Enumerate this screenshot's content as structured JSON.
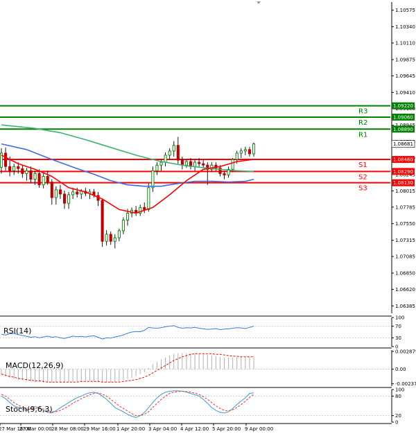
{
  "chart_data": [
    {
      "type": "candlestick",
      "title": "",
      "y_ticks": [
        "1.10575",
        "1.10340",
        "1.10110",
        "1.09875",
        "1.09645",
        "1.09410",
        "1.09180",
        "1.08945",
        "1.08710",
        "1.08480",
        "1.08245",
        "1.08015",
        "1.07785",
        "1.07550",
        "1.07315",
        "1.07085",
        "1.06850",
        "1.06620",
        "1.06385"
      ],
      "ylim": [
        1.0628,
        1.1069
      ],
      "x_ticks": [
        "27 Mar 16:00",
        "27 Mar 00:00",
        "28 Mar 08:00",
        "29 Mar 16:00",
        "1 Apr 20:00",
        "3 Apr 04:00",
        "4 Apr 12:00",
        "5 Apr 20:00",
        "9 Apr 00:00"
      ],
      "current_price": "1.08681",
      "levels": [
        {
          "name": "R3",
          "value": 1.0922,
          "label": "1.09220",
          "color": "#008000"
        },
        {
          "name": "R2",
          "value": 1.0906,
          "label": "1.09060",
          "color": "#008000"
        },
        {
          "name": "R1",
          "value": 1.0889,
          "label": "1.08890",
          "color": "#008000"
        },
        {
          "name": "S1",
          "value": 1.0846,
          "label": "1.08460",
          "color": "#ff0000"
        },
        {
          "name": "S2",
          "value": 1.0829,
          "label": "1.08290",
          "color": "#ff0000"
        },
        {
          "name": "S3",
          "value": 1.0813,
          "label": "1.08130",
          "color": "#ff0000"
        }
      ],
      "candles": [
        {
          "o": 1.0835,
          "h": 1.0862,
          "l": 1.0826,
          "c": 1.0855
        },
        {
          "o": 1.0855,
          "h": 1.0863,
          "l": 1.083,
          "c": 1.0836
        },
        {
          "o": 1.0836,
          "h": 1.085,
          "l": 1.0822,
          "c": 1.083
        },
        {
          "o": 1.083,
          "h": 1.084,
          "l": 1.0824,
          "c": 1.0836
        },
        {
          "o": 1.0836,
          "h": 1.0842,
          "l": 1.0826,
          "c": 1.0833
        },
        {
          "o": 1.0833,
          "h": 1.0838,
          "l": 1.082,
          "c": 1.0826
        },
        {
          "o": 1.0826,
          "h": 1.0834,
          "l": 1.0816,
          "c": 1.083
        },
        {
          "o": 1.083,
          "h": 1.0836,
          "l": 1.0812,
          "c": 1.0818
        },
        {
          "o": 1.0818,
          "h": 1.083,
          "l": 1.081,
          "c": 1.0826
        },
        {
          "o": 1.0826,
          "h": 1.0832,
          "l": 1.0806,
          "c": 1.081
        },
        {
          "o": 1.081,
          "h": 1.0826,
          "l": 1.0805,
          "c": 1.0822
        },
        {
          "o": 1.0822,
          "h": 1.083,
          "l": 1.081,
          "c": 1.0814
        },
        {
          "o": 1.0814,
          "h": 1.0818,
          "l": 1.0782,
          "c": 1.0792
        },
        {
          "o": 1.0792,
          "h": 1.0808,
          "l": 1.0782,
          "c": 1.0803
        },
        {
          "o": 1.0803,
          "h": 1.081,
          "l": 1.079,
          "c": 1.0797
        },
        {
          "o": 1.0797,
          "h": 1.0802,
          "l": 1.0776,
          "c": 1.0784
        },
        {
          "o": 1.0784,
          "h": 1.08,
          "l": 1.0776,
          "c": 1.0796
        },
        {
          "o": 1.0796,
          "h": 1.0806,
          "l": 1.079,
          "c": 1.08
        },
        {
          "o": 1.08,
          "h": 1.0806,
          "l": 1.0792,
          "c": 1.0797
        },
        {
          "o": 1.0797,
          "h": 1.0804,
          "l": 1.079,
          "c": 1.0801
        },
        {
          "o": 1.0801,
          "h": 1.0806,
          "l": 1.0794,
          "c": 1.0798
        },
        {
          "o": 1.0798,
          "h": 1.0804,
          "l": 1.079,
          "c": 1.08
        },
        {
          "o": 1.08,
          "h": 1.0804,
          "l": 1.0792,
          "c": 1.0795
        },
        {
          "o": 1.0795,
          "h": 1.08,
          "l": 1.078,
          "c": 1.0788
        },
        {
          "o": 1.0788,
          "h": 1.079,
          "l": 1.0722,
          "c": 1.073
        },
        {
          "o": 1.073,
          "h": 1.0746,
          "l": 1.0724,
          "c": 1.074
        },
        {
          "o": 1.074,
          "h": 1.0744,
          "l": 1.0725,
          "c": 1.073
        },
        {
          "o": 1.073,
          "h": 1.074,
          "l": 1.072,
          "c": 1.0735
        },
        {
          "o": 1.0735,
          "h": 1.0748,
          "l": 1.073,
          "c": 1.0745
        },
        {
          "o": 1.0745,
          "h": 1.0764,
          "l": 1.074,
          "c": 1.076
        },
        {
          "o": 1.076,
          "h": 1.0776,
          "l": 1.0752,
          "c": 1.077
        },
        {
          "o": 1.077,
          "h": 1.0778,
          "l": 1.0764,
          "c": 1.0774
        },
        {
          "o": 1.0774,
          "h": 1.078,
          "l": 1.0766,
          "c": 1.077
        },
        {
          "o": 1.077,
          "h": 1.0782,
          "l": 1.0766,
          "c": 1.0778
        },
        {
          "o": 1.0778,
          "h": 1.0785,
          "l": 1.077,
          "c": 1.0775
        },
        {
          "o": 1.0775,
          "h": 1.0812,
          "l": 1.0772,
          "c": 1.0806
        },
        {
          "o": 1.0806,
          "h": 1.0836,
          "l": 1.08,
          "c": 1.083
        },
        {
          "o": 1.083,
          "h": 1.0842,
          "l": 1.0824,
          "c": 1.0838
        },
        {
          "o": 1.0838,
          "h": 1.0846,
          "l": 1.083,
          "c": 1.0842
        },
        {
          "o": 1.0842,
          "h": 1.0856,
          "l": 1.0836,
          "c": 1.0852
        },
        {
          "o": 1.0852,
          "h": 1.0862,
          "l": 1.0846,
          "c": 1.0858
        },
        {
          "o": 1.0858,
          "h": 1.0872,
          "l": 1.085,
          "c": 1.0866
        },
        {
          "o": 1.0866,
          "h": 1.0878,
          "l": 1.084,
          "c": 1.0845
        },
        {
          "o": 1.0845,
          "h": 1.085,
          "l": 1.0832,
          "c": 1.0838
        },
        {
          "o": 1.0838,
          "h": 1.0846,
          "l": 1.0834,
          "c": 1.0843
        },
        {
          "o": 1.0843,
          "h": 1.0848,
          "l": 1.0832,
          "c": 1.0836
        },
        {
          "o": 1.0836,
          "h": 1.0846,
          "l": 1.083,
          "c": 1.0842
        },
        {
          "o": 1.0842,
          "h": 1.0848,
          "l": 1.0836,
          "c": 1.084
        },
        {
          "o": 1.084,
          "h": 1.0846,
          "l": 1.0834,
          "c": 1.0838
        },
        {
          "o": 1.0838,
          "h": 1.0842,
          "l": 1.081,
          "c": 1.0832
        },
        {
          "o": 1.0832,
          "h": 1.0842,
          "l": 1.0828,
          "c": 1.0838
        },
        {
          "o": 1.0838,
          "h": 1.0842,
          "l": 1.083,
          "c": 1.0834
        },
        {
          "o": 1.0834,
          "h": 1.0838,
          "l": 1.0822,
          "c": 1.0826
        },
        {
          "o": 1.0826,
          "h": 1.083,
          "l": 1.0818,
          "c": 1.0824
        },
        {
          "o": 1.0824,
          "h": 1.0836,
          "l": 1.082,
          "c": 1.0832
        },
        {
          "o": 1.0832,
          "h": 1.0848,
          "l": 1.0828,
          "c": 1.0846
        },
        {
          "o": 1.0846,
          "h": 1.0858,
          "l": 1.084,
          "c": 1.0855
        },
        {
          "o": 1.0855,
          "h": 1.0862,
          "l": 1.0848,
          "c": 1.0858
        },
        {
          "o": 1.0858,
          "h": 1.0864,
          "l": 1.0852,
          "c": 1.086
        },
        {
          "o": 1.086,
          "h": 1.0864,
          "l": 1.085,
          "c": 1.0854
        },
        {
          "o": 1.0854,
          "h": 1.087,
          "l": 1.085,
          "c": 1.0868
        }
      ],
      "ma_series": [
        {
          "color": "#3cb371",
          "points": [
            [
              0,
              1.0895
            ],
            [
              8,
              1.089
            ],
            [
              14,
              1.0884
            ],
            [
              20,
              1.0874
            ],
            [
              26,
              1.0863
            ],
            [
              32,
              1.0852
            ],
            [
              38,
              1.0843
            ],
            [
              44,
              1.0837
            ],
            [
              50,
              1.0833
            ],
            [
              56,
              1.083
            ],
            [
              60,
              1.0829
            ]
          ]
        },
        {
          "color": "#4169e1",
          "points": [
            [
              0,
              1.0868
            ],
            [
              6,
              1.086
            ],
            [
              12,
              1.0846
            ],
            [
              18,
              1.0833
            ],
            [
              22,
              1.0825
            ],
            [
              26,
              1.0816
            ],
            [
              30,
              1.081
            ],
            [
              34,
              1.0808
            ],
            [
              38,
              1.0808
            ],
            [
              42,
              1.0812
            ],
            [
              46,
              1.0815
            ],
            [
              50,
              1.0815
            ],
            [
              54,
              1.0814
            ],
            [
              58,
              1.0815
            ],
            [
              60,
              1.0818
            ]
          ]
        },
        {
          "color": "#ff0000",
          "points": [
            [
              0,
              1.0852
            ],
            [
              4,
              1.084
            ],
            [
              8,
              1.0832
            ],
            [
              12,
              1.0822
            ],
            [
              16,
              1.0806
            ],
            [
              20,
              1.08
            ],
            [
              24,
              1.079
            ],
            [
              28,
              1.0775
            ],
            [
              32,
              1.077
            ],
            [
              36,
              1.0778
            ],
            [
              40,
              1.0796
            ],
            [
              44,
              1.0816
            ],
            [
              48,
              1.0832
            ],
            [
              52,
              1.0836
            ],
            [
              56,
              1.0843
            ],
            [
              60,
              1.0846
            ]
          ]
        }
      ]
    },
    {
      "type": "line",
      "name": "RSI(14)",
      "y_ticks": [
        "100",
        "70",
        "30",
        "0"
      ],
      "ylim": [
        0,
        100
      ],
      "series": [
        {
          "color": "#3a7bd5",
          "values": [
            42,
            40,
            44,
            45,
            41,
            38,
            35,
            32,
            34,
            30,
            33,
            36,
            32,
            34,
            30,
            28,
            32,
            36,
            34,
            35,
            33,
            36,
            37,
            32,
            26,
            30,
            29,
            33,
            36,
            40,
            46,
            50,
            52,
            51,
            56,
            66,
            64,
            63,
            65,
            68,
            70,
            72,
            66,
            63,
            65,
            64,
            66,
            63,
            61,
            59,
            60,
            62,
            58,
            60,
            61,
            63,
            65,
            64,
            62,
            66,
            70
          ]
        }
      ]
    },
    {
      "type": "bar",
      "name": "MACD(12,26,9)",
      "y_ticks": [
        "0.002879",
        "0.00",
        "-0.002379"
      ],
      "ylim": [
        -0.00275,
        0.0031
      ],
      "histogram": [
        -0.001,
        -0.0012,
        -0.0014,
        -0.0016,
        -0.0017,
        -0.0018,
        -0.0019,
        -0.002,
        -0.0021,
        -0.0021,
        -0.0022,
        -0.0022,
        -0.0022,
        -0.0022,
        -0.0022,
        -0.0022,
        -0.0021,
        -0.0021,
        -0.002,
        -0.002,
        -0.0019,
        -0.0019,
        -0.002,
        -0.0021,
        -0.0022,
        -0.0022,
        -0.0022,
        -0.0021,
        -0.002,
        -0.0018,
        -0.0016,
        -0.0014,
        -0.0011,
        -0.0008,
        -0.0005,
        0.0002,
        0.0008,
        0.0012,
        0.0016,
        0.0019,
        0.0022,
        0.0025,
        0.0026,
        0.0026,
        0.0026,
        0.0026,
        0.0026,
        0.0025,
        0.0024,
        0.0023,
        0.0022,
        0.0021,
        0.002,
        0.0019,
        0.0019,
        0.0019,
        0.002,
        0.002,
        0.002,
        0.002,
        0.0021
      ],
      "signal": [
        -0.0008,
        -0.001,
        -0.0012,
        -0.0013,
        -0.0015,
        -0.0016,
        -0.0017,
        -0.0018,
        -0.0019,
        -0.0019,
        -0.002,
        -0.0021,
        -0.0021,
        -0.0021,
        -0.0021,
        -0.0021,
        -0.0021,
        -0.0021,
        -0.0021,
        -0.002,
        -0.002,
        -0.002,
        -0.002,
        -0.002,
        -0.0021,
        -0.0021,
        -0.0021,
        -0.0021,
        -0.0021,
        -0.002,
        -0.0019,
        -0.0018,
        -0.0017,
        -0.0015,
        -0.0013,
        -0.001,
        -0.0006,
        -0.0002,
        0.0002,
        0.0006,
        0.001,
        0.0014,
        0.0017,
        0.002,
        0.0022,
        0.0024,
        0.0025,
        0.0025,
        0.0025,
        0.0025,
        0.0025,
        0.0024,
        0.0024,
        0.0023,
        0.0022,
        0.0021,
        0.0021,
        0.002,
        0.002,
        0.002,
        0.002
      ]
    },
    {
      "type": "line",
      "name": "Stoch(9,6,3)",
      "y_ticks": [
        "100",
        "80",
        "20",
        "0"
      ],
      "ylim": [
        0,
        100
      ],
      "series": [
        {
          "color": "#3a9bd5",
          "values": [
            80,
            72,
            60,
            50,
            45,
            40,
            36,
            42,
            48,
            44,
            36,
            30,
            28,
            35,
            44,
            52,
            60,
            68,
            75,
            80,
            86,
            90,
            92,
            88,
            80,
            70,
            58,
            45,
            38,
            32,
            24,
            18,
            14,
            20,
            30,
            45,
            60,
            75,
            85,
            92,
            95,
            96,
            96,
            95,
            92,
            88,
            84,
            80,
            70,
            58,
            45,
            36,
            30,
            28,
            32,
            42,
            54,
            65,
            75,
            88,
            90
          ]
        },
        {
          "color": "#ff3030",
          "dash": "3,2",
          "values": [
            85,
            80,
            70,
            60,
            52,
            46,
            40,
            40,
            42,
            44,
            40,
            35,
            32,
            32,
            36,
            42,
            50,
            58,
            65,
            72,
            78,
            84,
            88,
            90,
            86,
            80,
            70,
            60,
            50,
            42,
            34,
            26,
            20,
            20,
            24,
            32,
            45,
            58,
            70,
            80,
            88,
            92,
            94,
            95,
            94,
            92,
            89,
            85,
            78,
            70,
            60,
            50,
            42,
            36,
            34,
            38,
            45,
            54,
            64,
            76,
            85
          ]
        }
      ]
    }
  ]
}
